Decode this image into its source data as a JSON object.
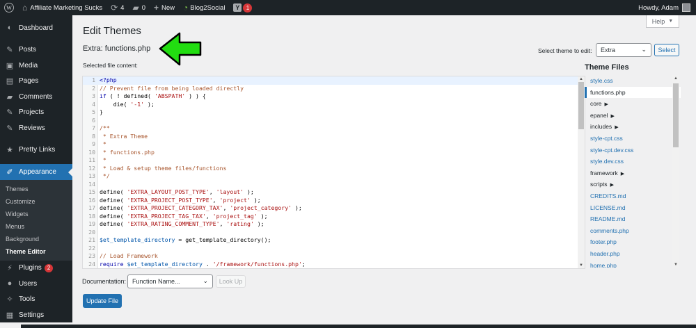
{
  "adminbar": {
    "site_name": "Affiliate Marketing Sucks",
    "updates_count": "4",
    "comments_count": "0",
    "new_label": "New",
    "blog2social_label": "Blog2Social",
    "yoast_badge": "1",
    "howdy": "Howdy, Adam"
  },
  "sidebar": {
    "items_top": [
      {
        "label": "Dashboard",
        "icon": "dashboard-icon"
      },
      {
        "label": "Posts",
        "icon": "pin-icon"
      },
      {
        "label": "Media",
        "icon": "media-icon"
      },
      {
        "label": "Pages",
        "icon": "pages-icon"
      },
      {
        "label": "Comments",
        "icon": "comment-icon"
      },
      {
        "label": "Projects",
        "icon": "pin-icon"
      },
      {
        "label": "Reviews",
        "icon": "pin-icon"
      },
      {
        "label": "Pretty Links",
        "icon": "link-icon"
      },
      {
        "label": "Appearance",
        "icon": "brush-icon"
      }
    ],
    "submenu": [
      "Themes",
      "Customize",
      "Widgets",
      "Menus",
      "Background",
      "Theme Editor"
    ],
    "items_bottom": [
      {
        "label": "Plugins",
        "icon": "plugin-icon",
        "badge": "2"
      },
      {
        "label": "Users",
        "icon": "user-icon"
      },
      {
        "label": "Tools",
        "icon": "wrench-icon"
      },
      {
        "label": "Settings",
        "icon": "settings-icon"
      }
    ]
  },
  "main": {
    "page_title": "Edit Themes",
    "help_label": "Help",
    "file_title": "Extra: functions.php",
    "select_theme_label": "Select theme to edit:",
    "selected_theme": "Extra",
    "select_button": "Select",
    "selected_file_label": "Selected file content:",
    "documentation_label": "Documentation:",
    "function_placeholder": "Function Name...",
    "lookup_button": "Look Up",
    "update_button": "Update File"
  },
  "theme_files": {
    "title": "Theme Files",
    "items": [
      {
        "name": "style.css",
        "type": "file"
      },
      {
        "name": "functions.php",
        "type": "file",
        "current": true
      },
      {
        "name": "core",
        "type": "folder"
      },
      {
        "name": "epanel",
        "type": "folder"
      },
      {
        "name": "includes",
        "type": "folder"
      },
      {
        "name": "style-cpt.css",
        "type": "file"
      },
      {
        "name": "style-cpt.dev.css",
        "type": "file"
      },
      {
        "name": "style.dev.css",
        "type": "file"
      },
      {
        "name": "framework",
        "type": "folder"
      },
      {
        "name": "scripts",
        "type": "folder"
      },
      {
        "name": "CREDITS.md",
        "type": "file"
      },
      {
        "name": "LICENSE.md",
        "type": "file"
      },
      {
        "name": "README.md",
        "type": "file"
      },
      {
        "name": "comments.php",
        "type": "file"
      },
      {
        "name": "footer.php",
        "type": "file"
      },
      {
        "name": "header.php",
        "type": "file"
      },
      {
        "name": "home.php",
        "type": "file"
      }
    ]
  },
  "code_lines": [
    [
      {
        "t": "<?php",
        "c": "kw"
      }
    ],
    [
      {
        "t": "// Prevent file from being loaded directly",
        "c": "cmt"
      }
    ],
    [
      {
        "t": "if",
        "c": "kw"
      },
      {
        "t": " ( ! defined( "
      },
      {
        "t": "'ABSPATH'",
        "c": "str"
      },
      {
        "t": " ) ) {"
      }
    ],
    [
      {
        "t": "    die( "
      },
      {
        "t": "'-1'",
        "c": "str"
      },
      {
        "t": " );"
      }
    ],
    [
      {
        "t": "}"
      }
    ],
    [
      {
        "t": ""
      }
    ],
    [
      {
        "t": "/**",
        "c": "cmt"
      }
    ],
    [
      {
        "t": " * Extra Theme",
        "c": "cmt"
      }
    ],
    [
      {
        "t": " *",
        "c": "cmt"
      }
    ],
    [
      {
        "t": " * functions.php",
        "c": "cmt"
      }
    ],
    [
      {
        "t": " *",
        "c": "cmt"
      }
    ],
    [
      {
        "t": " * Load & setup theme files/functions",
        "c": "cmt"
      }
    ],
    [
      {
        "t": " */",
        "c": "cmt"
      }
    ],
    [
      {
        "t": ""
      }
    ],
    [
      {
        "t": "define( "
      },
      {
        "t": "'EXTRA_LAYOUT_POST_TYPE'",
        "c": "str"
      },
      {
        "t": ", "
      },
      {
        "t": "'layout'",
        "c": "str"
      },
      {
        "t": " );"
      }
    ],
    [
      {
        "t": "define( "
      },
      {
        "t": "'EXTRA_PROJECT_POST_TYPE'",
        "c": "str"
      },
      {
        "t": ", "
      },
      {
        "t": "'project'",
        "c": "str"
      },
      {
        "t": " );"
      }
    ],
    [
      {
        "t": "define( "
      },
      {
        "t": "'EXTRA_PROJECT_CATEGORY_TAX'",
        "c": "str"
      },
      {
        "t": ", "
      },
      {
        "t": "'project_category'",
        "c": "str"
      },
      {
        "t": " );"
      }
    ],
    [
      {
        "t": "define( "
      },
      {
        "t": "'EXTRA_PROJECT_TAG_TAX'",
        "c": "str"
      },
      {
        "t": ", "
      },
      {
        "t": "'project_tag'",
        "c": "str"
      },
      {
        "t": " );"
      }
    ],
    [
      {
        "t": "define( "
      },
      {
        "t": "'EXTRA_RATING_COMMENT_TYPE'",
        "c": "str"
      },
      {
        "t": ", "
      },
      {
        "t": "'rating'",
        "c": "str"
      },
      {
        "t": " );"
      }
    ],
    [
      {
        "t": ""
      }
    ],
    [
      {
        "t": "$et_template_directory",
        "c": "var"
      },
      {
        "t": " = get_template_directory();"
      }
    ],
    [
      {
        "t": ""
      }
    ],
    [
      {
        "t": "// Load Framework",
        "c": "cmt"
      }
    ],
    [
      {
        "t": "require ",
        "c": "kw"
      },
      {
        "t": "$et_template_directory",
        "c": "var"
      },
      {
        "t": " . "
      },
      {
        "t": "'/framework/functions.php'",
        "c": "str"
      },
      {
        "t": ";"
      }
    ]
  ]
}
